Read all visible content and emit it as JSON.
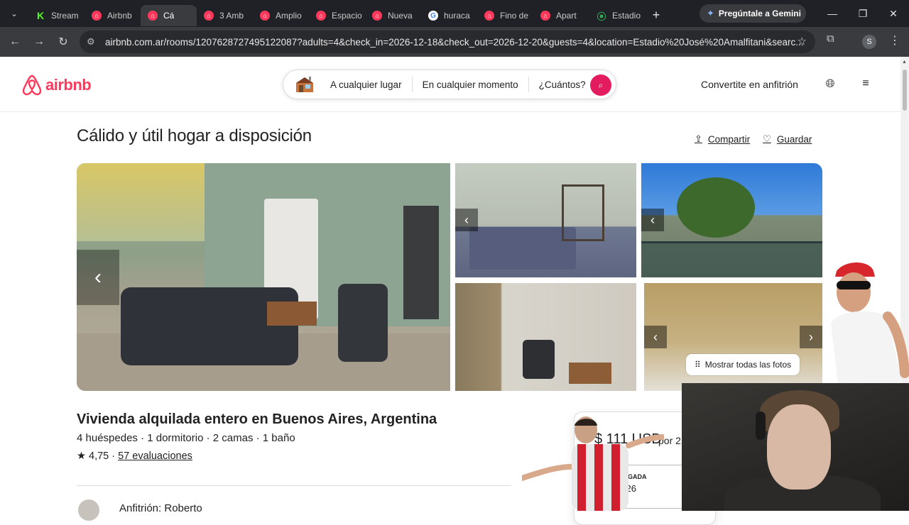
{
  "browser": {
    "tabs": [
      {
        "label": "Stream",
        "favicon": "kick"
      },
      {
        "label": "Airbnb",
        "favicon": "airbnb"
      },
      {
        "label": "Cá",
        "favicon": "airbnb",
        "active": true
      },
      {
        "label": "3 Amb",
        "favicon": "airbnb"
      },
      {
        "label": "Amplio",
        "favicon": "airbnb"
      },
      {
        "label": "Espacio",
        "favicon": "airbnb"
      },
      {
        "label": "Nueva",
        "favicon": "airbnb"
      },
      {
        "label": "huraca",
        "favicon": "google"
      },
      {
        "label": "Fino de",
        "favicon": "airbnb"
      },
      {
        "label": "Apart",
        "favicon": "airbnb"
      },
      {
        "label": "Estadio",
        "favicon": "maps"
      }
    ],
    "gemini_label": "Pregúntale a Gemini",
    "url": "airbnb.com.ar/rooms/1207628727495122087?adults=4&check_in=2026-12-18&check_out=2026-12-20&guests=4&location=Estadio%20José%20Amalfitani&searc...",
    "profile_initial": "S"
  },
  "header": {
    "logo_text": "airbnb",
    "search": {
      "where": "A cualquier lugar",
      "when": "En cualquier momento",
      "who": "¿Cuántos?"
    },
    "host_link": "Convertite en anfitrión",
    "brand_color": "#ff385c"
  },
  "listing": {
    "title": "Cálido y útil hogar a disposición",
    "share": "Compartir",
    "save": "Guardar",
    "show_all_photos": "Mostrar todas las fotos",
    "subtitle": "Vivienda alquilada entero en Buenos Aires, Argentina",
    "meta": "4 huéspedes · 1 dormitorio · 2 camas · 1 baño",
    "rating": "★ 4,75 ·",
    "reviews": "57 evaluaciones",
    "host": "Anfitrión: Roberto"
  },
  "price_card": {
    "price": "$ 111 USD",
    "per": "por 2",
    "checkin_label": "LLEGADA",
    "checkin_date": "2026"
  }
}
